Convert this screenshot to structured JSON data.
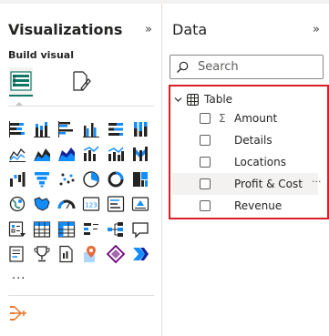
{
  "visualizations": {
    "title": "Visualizations",
    "collapse_glyph": "»",
    "build_label": "Build visual",
    "build_tabs": [
      {
        "icon": "build-visual-icon",
        "active": true
      },
      {
        "icon": "format-visual-icon",
        "active": false
      }
    ],
    "more_label": "...",
    "accent": "#117865",
    "icons": [
      [
        "stacked-bar-icon",
        "stacked-column-icon",
        "clustered-bar-icon",
        "clustered-column-icon",
        "100-stacked-bar-icon",
        "100-stacked-column-icon"
      ],
      [
        "line-chart-icon",
        "area-chart-icon",
        "stacked-area-icon",
        "line-clustered-column-icon",
        "line-stacked-column-icon",
        "ribbon-chart-icon"
      ],
      [
        "waterfall-chart-icon",
        "funnel-chart-icon",
        "scatter-chart-icon",
        "pie-chart-icon",
        "donut-chart-icon",
        "treemap-icon"
      ],
      [
        "map-icon",
        "filled-map-icon",
        "gauge-icon",
        "card-icon",
        "multi-row-card-icon",
        "kpi-icon"
      ],
      [
        "slicer-icon",
        "table-icon",
        "matrix-icon",
        "key-influencers-icon",
        "decomposition-tree-icon",
        "qa-icon"
      ],
      [
        "narrative-icon",
        "goals-icon",
        "paginated-report-icon",
        "azure-map-icon",
        "power-apps-icon",
        "power-automate-icon"
      ]
    ],
    "bottom_icon": "custom-visual-icon"
  },
  "data_pane": {
    "title": "Data",
    "collapse_glyph": "»",
    "search_placeholder": "Search",
    "table": {
      "label": "Table",
      "expanded": true,
      "fields": [
        {
          "label": "Amount",
          "aggregate": "Σ",
          "hover": false
        },
        {
          "label": "Details",
          "aggregate": "",
          "hover": false
        },
        {
          "label": "Locations",
          "aggregate": "",
          "hover": false
        },
        {
          "label": "Profit & Cost",
          "aggregate": "",
          "hover": true,
          "more": "···"
        },
        {
          "label": "Revenue",
          "aggregate": "",
          "hover": false
        }
      ]
    },
    "highlight_color": "#d91e2a"
  }
}
